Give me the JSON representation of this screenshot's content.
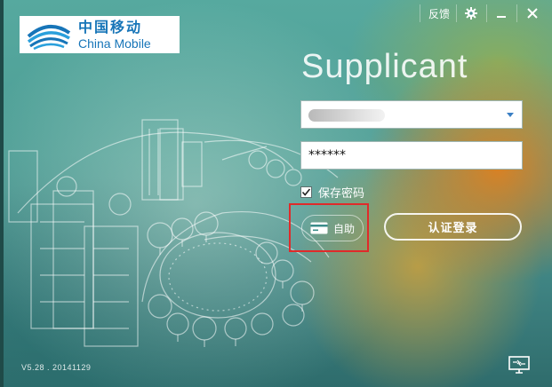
{
  "logo": {
    "name_cn": "中国移动",
    "name_en": "China Mobile"
  },
  "titlebar": {
    "feedback": "反馈"
  },
  "app": {
    "title": "Supplicant",
    "version": "V5.28 . 20141129"
  },
  "form": {
    "password_value": "******",
    "remember_label": "保存密码",
    "remember_checked": true,
    "self_service_label": "自助",
    "login_label": "认证登录"
  },
  "icons": {
    "gear": "gear-icon",
    "minimize": "minimize-icon",
    "close": "close-icon",
    "dropdown": "chevron-down-icon",
    "card": "card-icon",
    "monitor": "network-monitor-icon"
  },
  "colors": {
    "brand": "#1775b8",
    "highlight": "#e02a2a",
    "dropdown_arrow": "#3a7fc4"
  }
}
